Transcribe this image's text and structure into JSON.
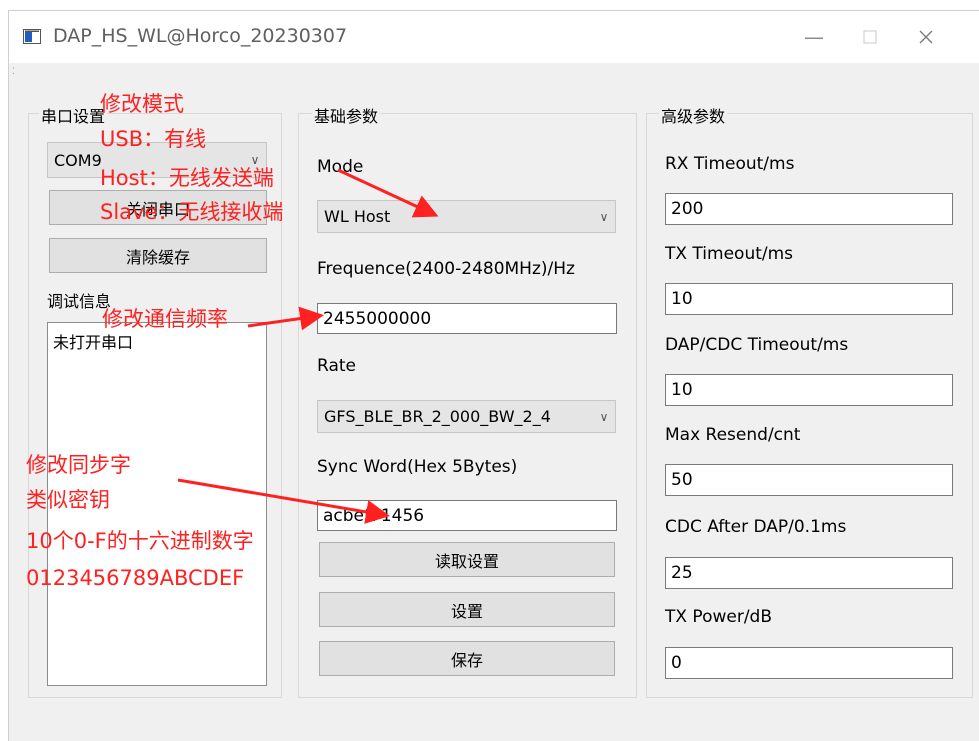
{
  "window": {
    "title": "DAP_HS_WL@Horco_20230307"
  },
  "serial": {
    "group_label": "串口设置",
    "port_selected": "COM9",
    "close_port_label": "关闭串口",
    "clear_cache_label": "清除缓存",
    "debug_info_label": "调试信息",
    "log_lines": [
      "未打开串口"
    ]
  },
  "basic": {
    "group_label": "基础参数",
    "mode_label": "Mode",
    "mode_value": "WL Host",
    "freq_label": "Frequence(2400-2480MHz)/Hz",
    "freq_value": "2455000000",
    "rate_label": "Rate",
    "rate_value": "GFS_BLE_BR_2_000_BW_2_4",
    "sync_label": "Sync Word(Hex 5Bytes)",
    "sync_value": "acbef71456",
    "read_label": "读取设置",
    "set_label": "设置",
    "save_label": "保存"
  },
  "advanced": {
    "group_label": "高级参数",
    "fields": [
      {
        "label": "RX Timeout/ms",
        "value": "200"
      },
      {
        "label": "TX Timeout/ms",
        "value": "10"
      },
      {
        "label": "DAP/CDC Timeout/ms",
        "value": "10"
      },
      {
        "label": "Max Resend/cnt",
        "value": "50"
      },
      {
        "label": "CDC After DAP/0.1ms",
        "value": "25"
      },
      {
        "label": "TX Power/dB",
        "value": "0"
      }
    ]
  },
  "annotations": {
    "mode": [
      "修改模式",
      "USB：有线",
      "Host：无线发送端",
      "Slave：无线接收端"
    ],
    "freq": "修改通信频率",
    "sync": [
      "修改同步字",
      "类似密钥",
      "10个0-F的十六进制数字",
      "0123456789ABCDEF"
    ]
  },
  "colors": {
    "annotation": "#ff2020",
    "window_bg": "#f0f0f0"
  }
}
